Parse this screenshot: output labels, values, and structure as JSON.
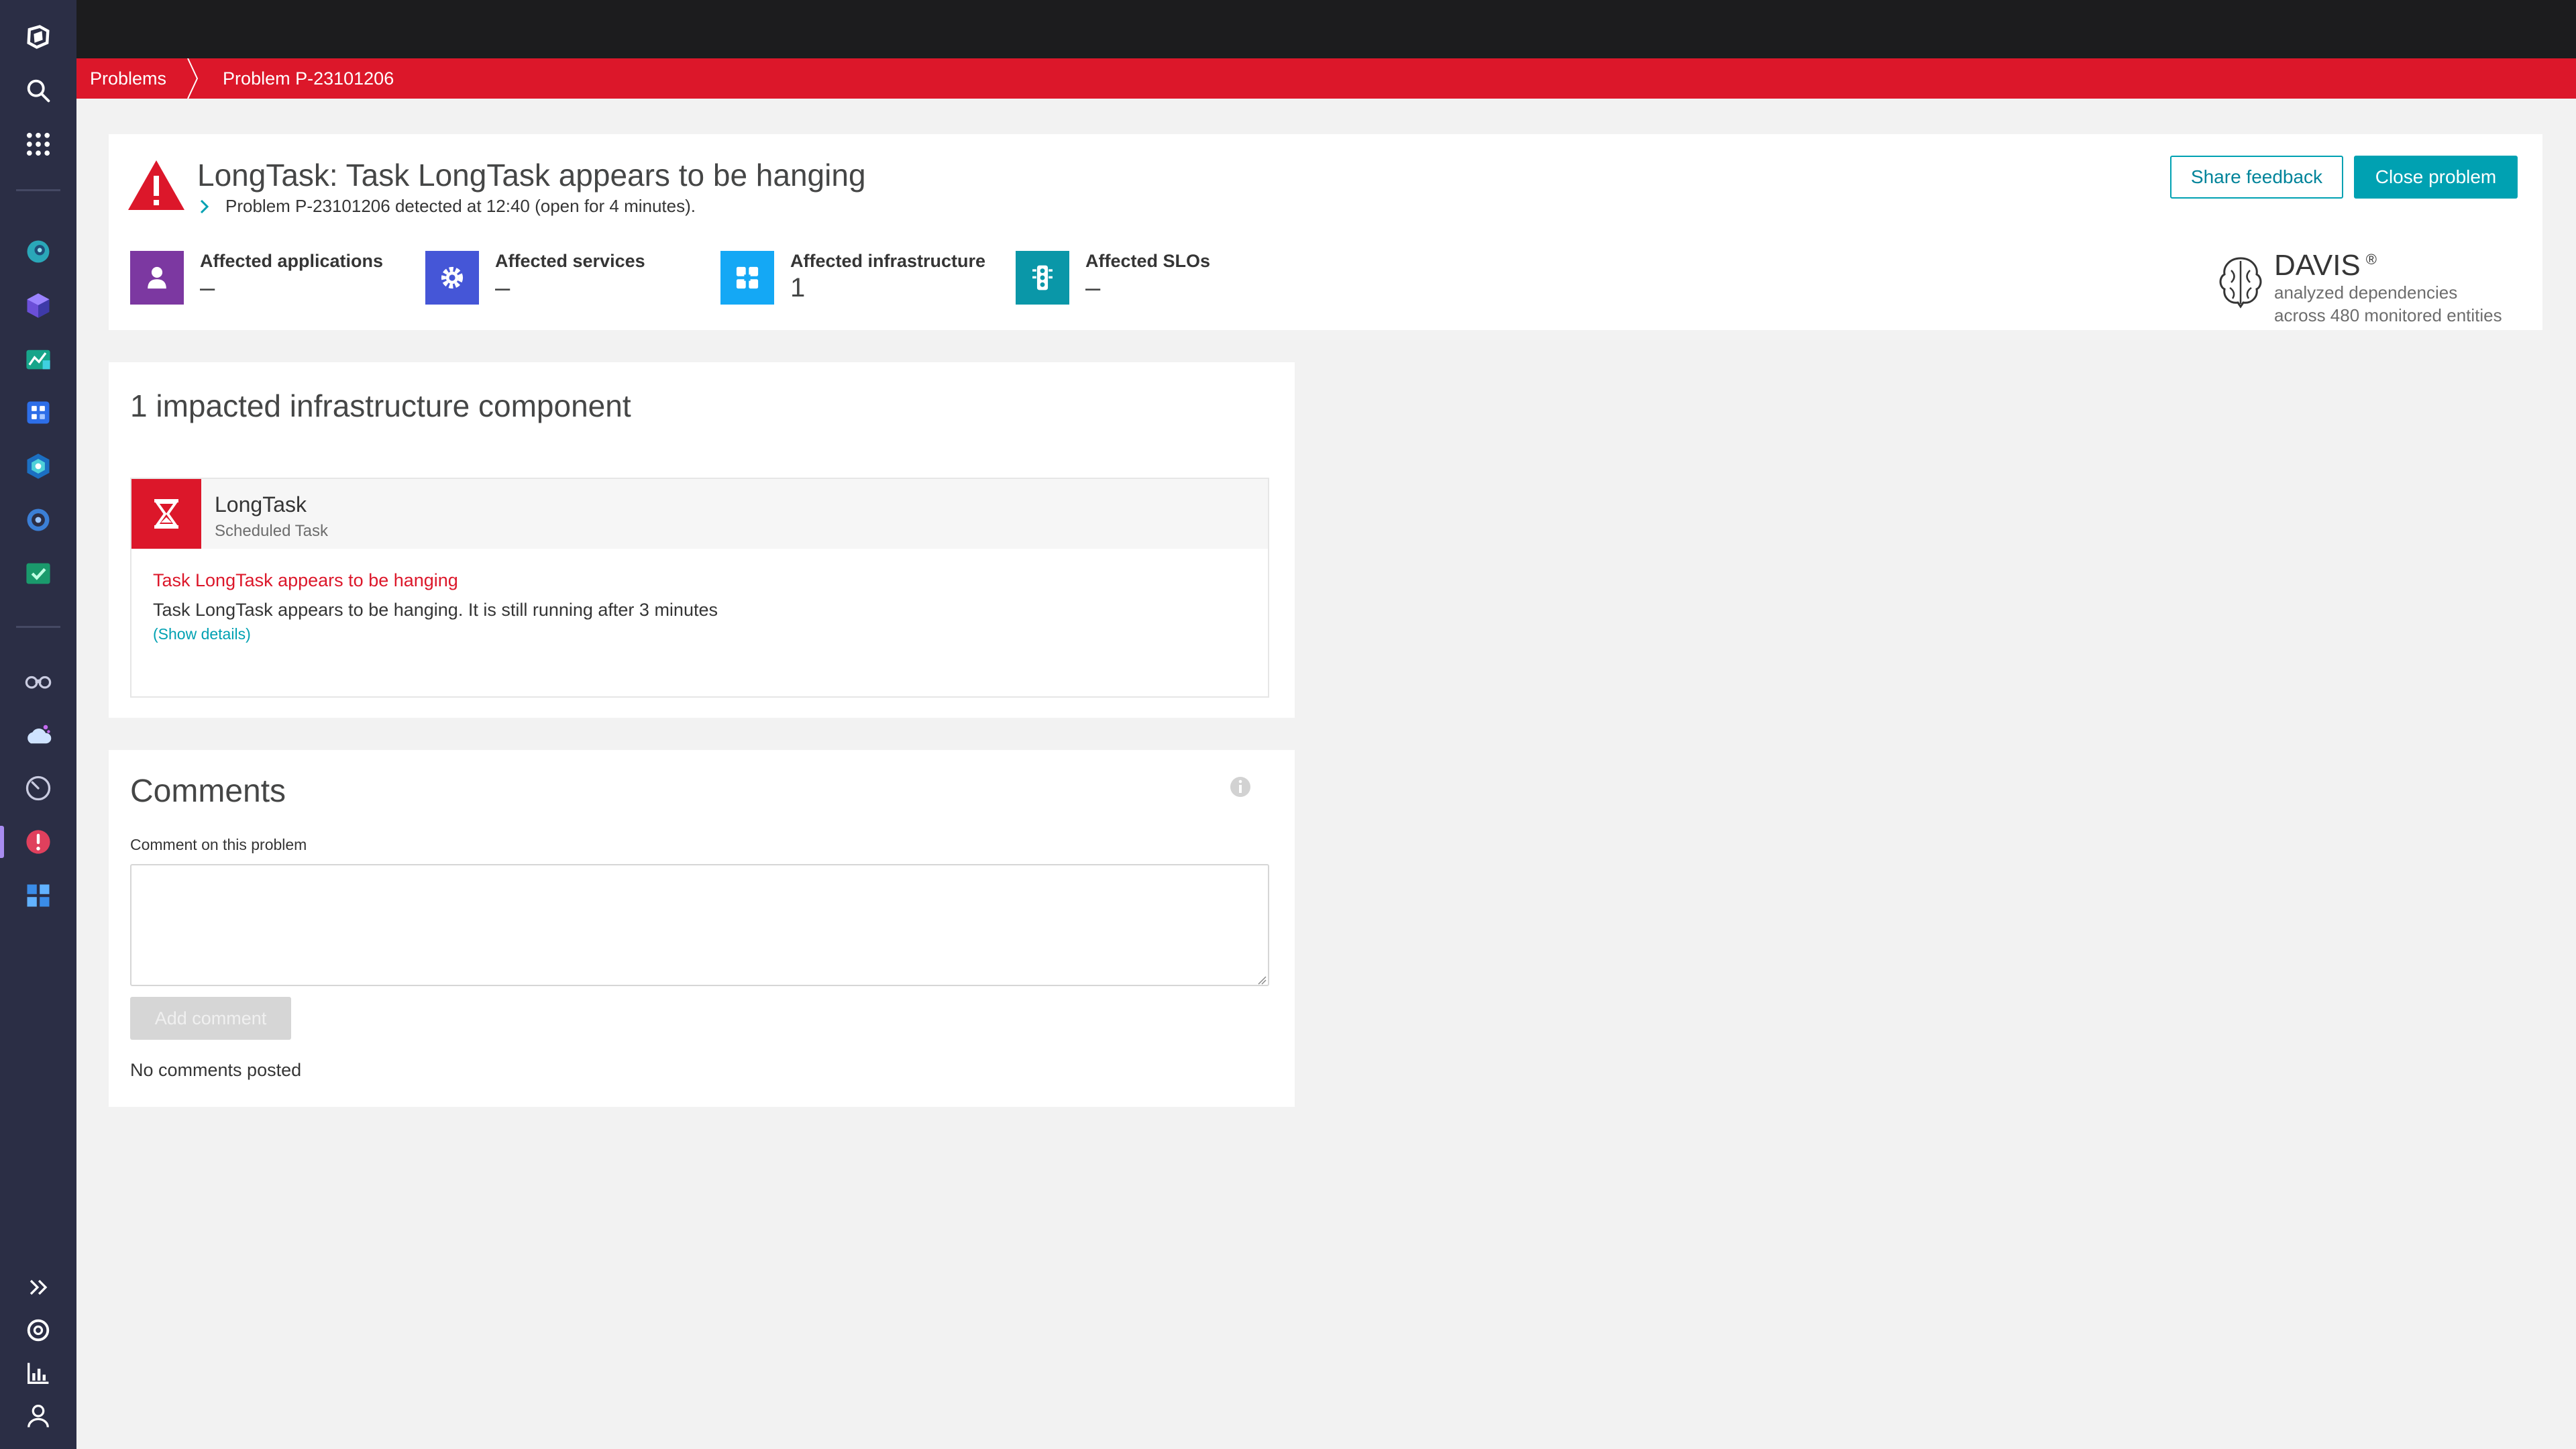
{
  "breadcrumb": {
    "root": "Problems",
    "current": "Problem P-23101206"
  },
  "problem": {
    "title": "LongTask: Task LongTask appears to be hanging",
    "subtitle": "Problem P-23101206 detected at 12:40 (open for 4 minutes).",
    "share_label": "Share feedback",
    "close_label": "Close problem"
  },
  "affected": [
    {
      "label": "Affected applications",
      "value": "–",
      "icon": "user-icon",
      "color": "#7c38a1"
    },
    {
      "label": "Affected services",
      "value": "–",
      "icon": "gear-icon",
      "color": "#4556d7"
    },
    {
      "label": "Affected infrastructure",
      "value": "1",
      "icon": "infrastructure-icon",
      "color": "#14a8f5"
    },
    {
      "label": "Affected SLOs",
      "value": "–",
      "icon": "traffic-light-icon",
      "color": "#0a97a8"
    }
  ],
  "davis": {
    "title": "DAVIS",
    "reg": "®",
    "line1": "analyzed dependencies",
    "line2": "across 480 monitored entities"
  },
  "impact": {
    "title": "1 impacted infrastructure component",
    "component_name": "LongTask",
    "component_type": "Scheduled Task",
    "event_title": "Task LongTask appears to be hanging",
    "event_desc": "Task LongTask appears to be hanging. It is still running after 3 minutes",
    "show_details": "(Show details)"
  },
  "comments": {
    "title": "Comments",
    "field_label": "Comment on this problem",
    "field_value": "",
    "add_label": "Add comment",
    "empty_text": "No comments posted"
  },
  "colors": {
    "accent": "#00a1b2",
    "error": "#dc172a",
    "nav_bg": "#2b2e45"
  }
}
